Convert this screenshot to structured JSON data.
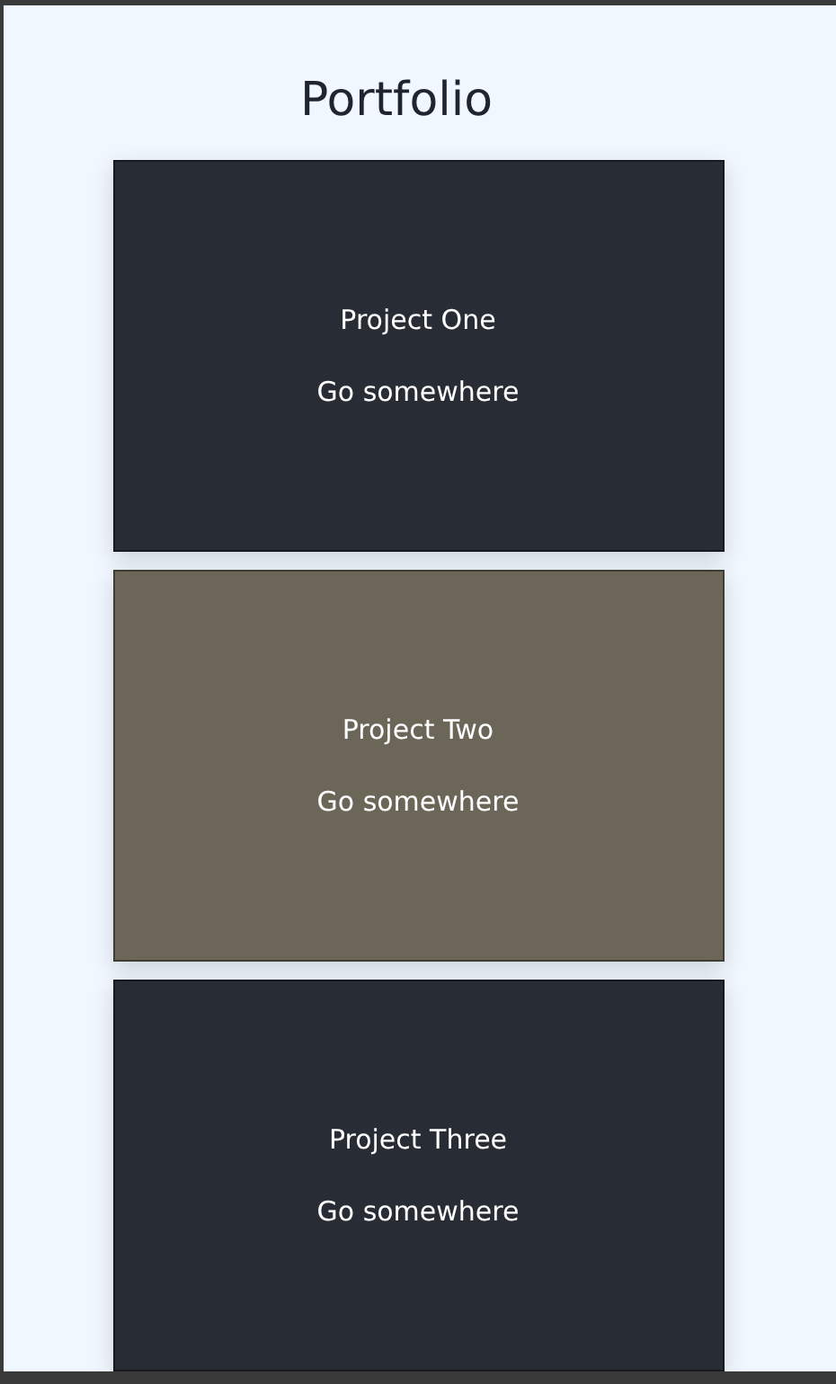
{
  "page": {
    "title": "Portfolio"
  },
  "projects": [
    {
      "title": "Project One",
      "link": "Go somewhere",
      "color": "#282c34"
    },
    {
      "title": "Project Two",
      "link": "Go somewhere",
      "color": "#6b6657"
    },
    {
      "title": "Project Three",
      "link": "Go somewhere",
      "color": "#282c34"
    }
  ]
}
